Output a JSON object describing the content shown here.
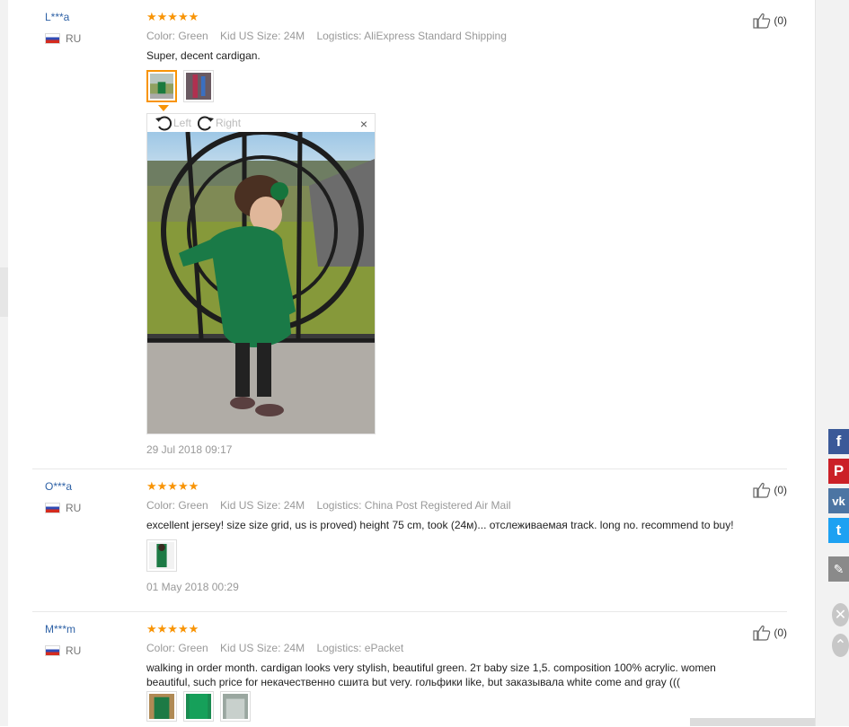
{
  "reviews": [
    {
      "user": "L***a",
      "country": "RU",
      "stars": "★★★★★",
      "color": "Color: Green",
      "size": "Kid US Size: 24M",
      "logistics": "Logistics: AliExpress Standard Shipping",
      "text": "Super, decent cardigan.",
      "date": "29 Jul 2018 09:17",
      "likes": "(0)"
    },
    {
      "user": "O***a",
      "country": "RU",
      "stars": "★★★★★",
      "color": "Color: Green",
      "size": "Kid US Size: 24M",
      "logistics": "Logistics: China Post Registered Air Mail",
      "text": "excellent jersey! size size grid, us is proved) height 75 cm, took (24м)... отслеживаемая track. long no. recommend to buy!",
      "date": "01 May 2018 00:29",
      "likes": "(0)"
    },
    {
      "user": "M***m",
      "country": "RU",
      "stars": "★★★★★",
      "color": "Color: Green",
      "size": "Kid US Size: 24M",
      "logistics": "Logistics: ePacket",
      "text": "walking in order month. cardigan looks very stylish, beautiful green. 2т baby size 1,5. composition 100% acrylic. women beautiful, such price for некачественно сшита but very. гольфики like, but заказывала white come and gray (((",
      "likes": "(0)"
    }
  ],
  "viewer": {
    "rotate_left": "Left",
    "rotate_right": "Right",
    "close": "×"
  },
  "share": {
    "facebook": "f",
    "pinterest": "P",
    "vk": "vk",
    "twitter": "t",
    "edit": "✎",
    "close": "✕",
    "up": "⌃"
  },
  "colors": {
    "star": "#f89406",
    "username": "#2f62a6",
    "facebook": "#3b5998",
    "pinterest": "#cb2027",
    "vk": "#4c75a3",
    "twitter": "#1da1f2"
  }
}
